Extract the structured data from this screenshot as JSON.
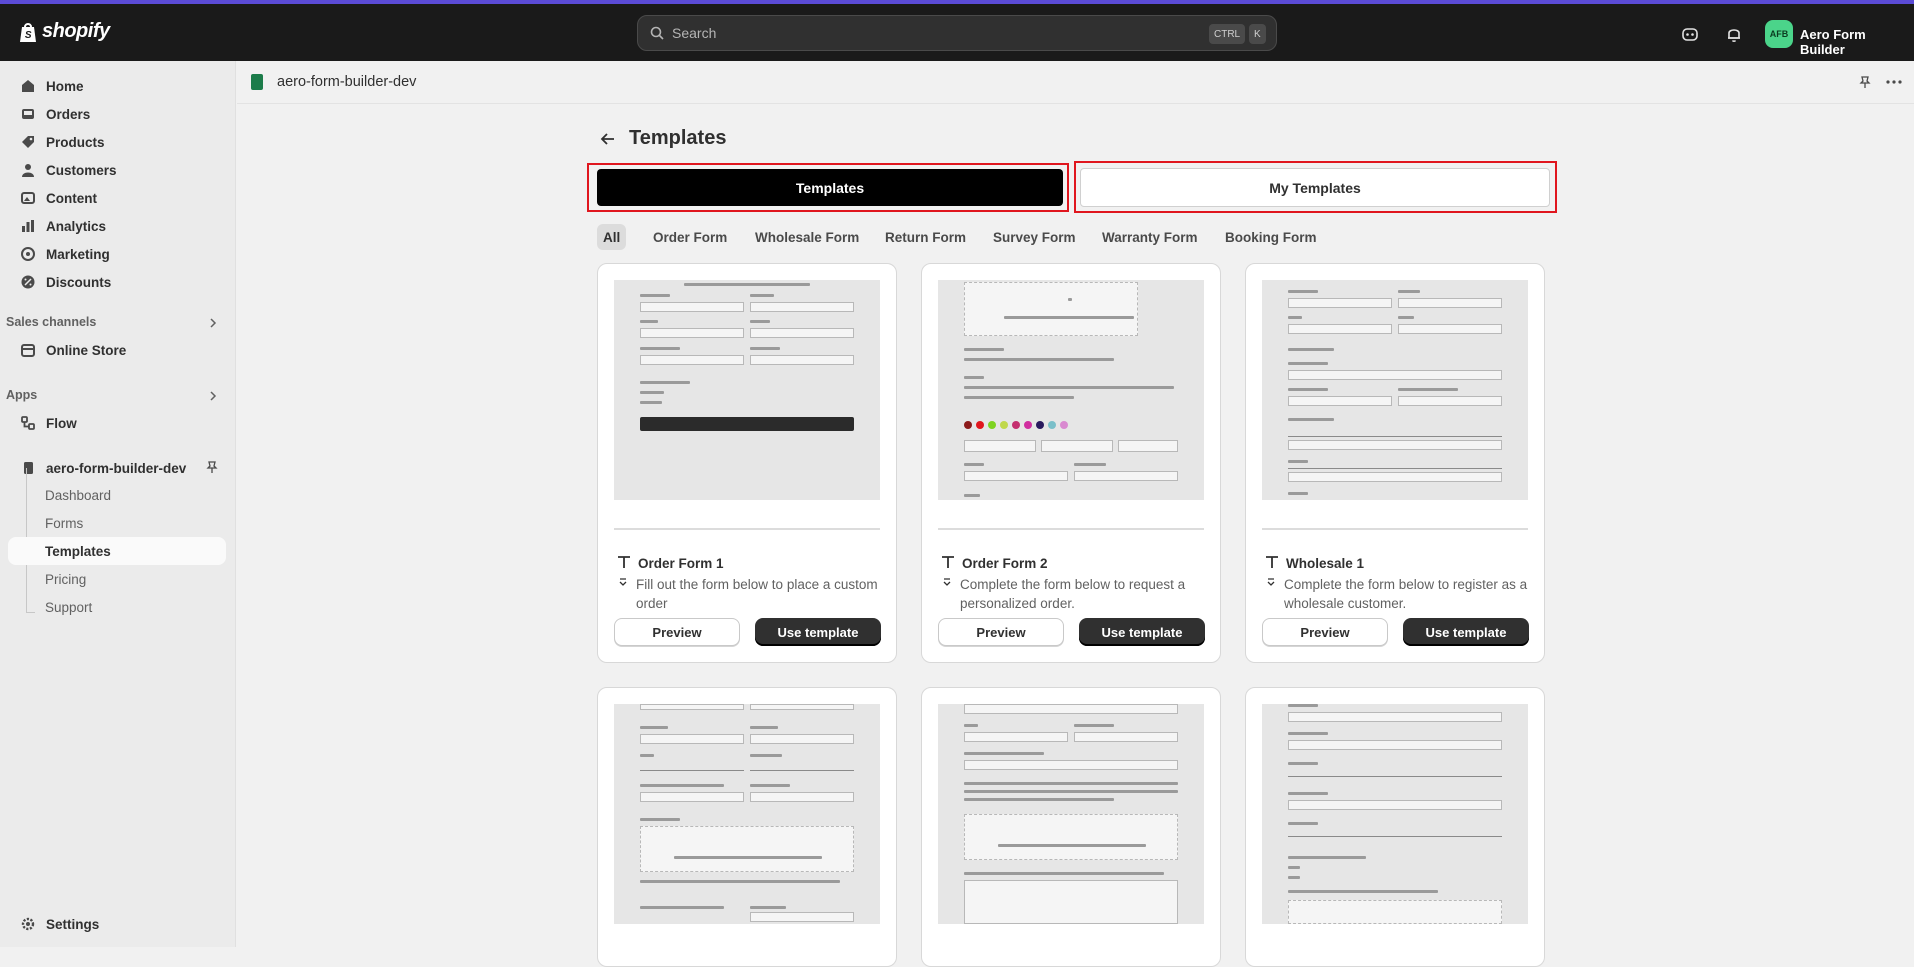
{
  "topbar": {
    "logo_text": "shopify",
    "search_placeholder": "Search",
    "shortcut_ctrl": "CTRL",
    "shortcut_k": "K",
    "avatar_initials": "AFB",
    "store_name": "Aero Form Builder"
  },
  "sidebar": {
    "items": [
      {
        "label": "Home",
        "icon": "home-icon"
      },
      {
        "label": "Orders",
        "icon": "inbox-icon"
      },
      {
        "label": "Products",
        "icon": "tag-icon"
      },
      {
        "label": "Customers",
        "icon": "person-icon"
      },
      {
        "label": "Content",
        "icon": "image-icon"
      },
      {
        "label": "Analytics",
        "icon": "bar-chart-icon"
      },
      {
        "label": "Marketing",
        "icon": "target-icon"
      },
      {
        "label": "Discounts",
        "icon": "discount-icon"
      }
    ],
    "sales_channels_label": "Sales channels",
    "online_store": "Online Store",
    "apps_label": "Apps",
    "flow": "Flow",
    "app_name": "aero-form-builder-dev",
    "sub_items": [
      "Dashboard",
      "Forms",
      "Templates",
      "Pricing",
      "Support"
    ],
    "active_sub": "Templates",
    "settings": "Settings"
  },
  "appbar": {
    "name": "aero-form-builder-dev"
  },
  "page": {
    "title": "Templates",
    "tabs": [
      "Templates",
      "My Templates"
    ],
    "active_tab": "Templates",
    "filters": [
      "All",
      "Order Form",
      "Wholesale Form",
      "Return Form",
      "Survey Form",
      "Warranty Form",
      "Booking Form"
    ],
    "active_filter": "All"
  },
  "cards": [
    {
      "title": "Order Form 1",
      "desc": "Fill out the form below to place a custom order",
      "preview": "Preview",
      "use": "Use template"
    },
    {
      "title": "Order Form 2",
      "desc": "Complete the form below to request a personalized order.",
      "preview": "Preview",
      "use": "Use template"
    },
    {
      "title": "Wholesale 1",
      "desc": "Complete the form below to register as a wholesale customer.",
      "preview": "Preview",
      "use": "Use template"
    }
  ],
  "colors": {
    "topbar_bg": "#1a1a1a",
    "accent_line": "#5b4bd6",
    "highlight_border": "#e0161e",
    "primary_button": "#303030",
    "avatar_bg": "#4bd48a",
    "swatches": [
      "#8b1a1a",
      "#e0161e",
      "#7ed321",
      "#c0d84b",
      "#c42f6f",
      "#d12fa0",
      "#2a1a5e",
      "#7abfc9",
      "#d98ad0"
    ]
  }
}
